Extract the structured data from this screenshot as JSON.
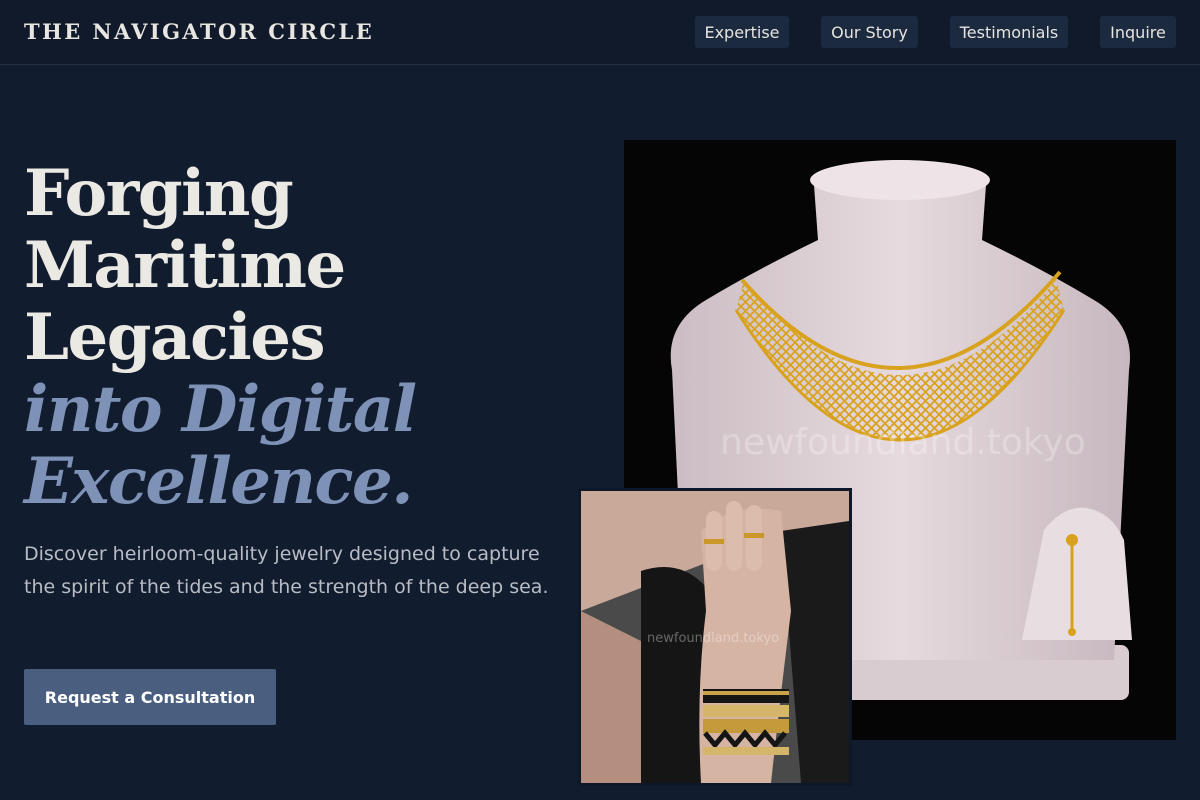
{
  "header": {
    "brand": "THE NAVIGATOR CIRCLE",
    "nav": [
      {
        "label": "Expertise"
      },
      {
        "label": "Our Story"
      },
      {
        "label": "Testimonials"
      },
      {
        "label": "Inquire"
      }
    ]
  },
  "hero": {
    "headline_lines": [
      "Forging",
      "Maritime",
      "Legacies"
    ],
    "headline_accent_lines": [
      "into Digital",
      "Excellence."
    ],
    "subtext": "Discover heirloom-quality jewelry designed to capture the spirit of the tides and the strength of the deep sea.",
    "cta_label": "Request a Consultation"
  },
  "images": {
    "main": {
      "subject": "gold-lattice-necklace-on-bust",
      "watermark": "newfoundland.tokyo"
    },
    "inset": {
      "subject": "hand-with-rings-and-bracelets",
      "watermark": "newfoundland.tokyo"
    }
  },
  "colors": {
    "background": "#111c2e",
    "header_bg": "#101a2b",
    "nav_button_bg": "#1c2a40",
    "accent_text": "#7d92b6",
    "cta_bg": "#4a5f80",
    "gold": "#d4a020"
  }
}
